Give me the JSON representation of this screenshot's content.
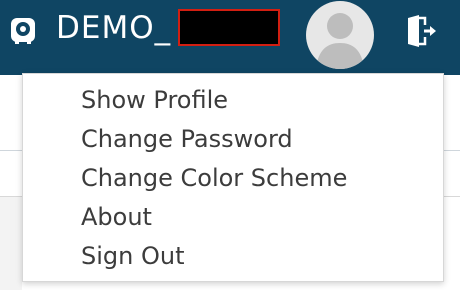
{
  "header": {
    "user_prefix": "DEMO_",
    "icons": {
      "app": "safe-vault-icon",
      "avatar": "user-avatar-icon",
      "exit": "logout-door-icon"
    },
    "colors": {
      "bar": "#0f4563",
      "redaction_border": "#d21f12"
    }
  },
  "menu": {
    "items": [
      {
        "label": "Show Profile"
      },
      {
        "label": "Change Password"
      },
      {
        "label": "Change Color Scheme"
      },
      {
        "label": "About"
      },
      {
        "label": "Sign Out"
      }
    ]
  }
}
